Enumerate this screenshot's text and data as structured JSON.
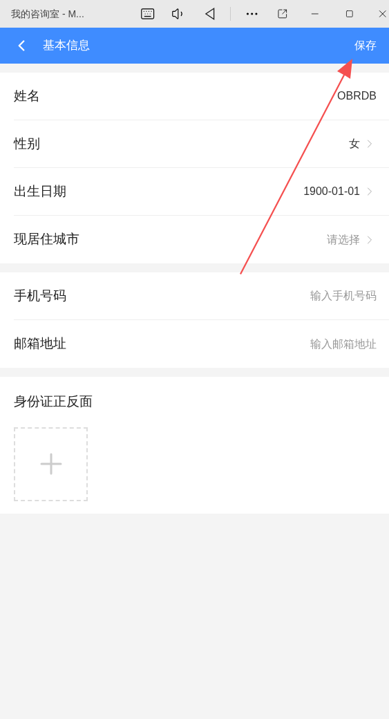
{
  "window": {
    "title": "我的咨询室 - M..."
  },
  "header": {
    "title": "基本信息",
    "action": "保存"
  },
  "sections": [
    {
      "fields": [
        {
          "kind": "text",
          "label": "姓名",
          "value": "OBRDB"
        },
        {
          "kind": "select",
          "label": "性别",
          "value": "女"
        },
        {
          "kind": "select",
          "label": "出生日期",
          "value": "1900-01-01"
        },
        {
          "kind": "select",
          "label": "现居住城市",
          "placeholder": "请选择"
        }
      ]
    },
    {
      "fields": [
        {
          "kind": "input",
          "label": "手机号码",
          "placeholder": "输入手机号码"
        },
        {
          "kind": "input",
          "label": "邮箱地址",
          "placeholder": "输入邮箱地址"
        }
      ]
    }
  ],
  "id_card": {
    "label": "身份证正反面"
  }
}
